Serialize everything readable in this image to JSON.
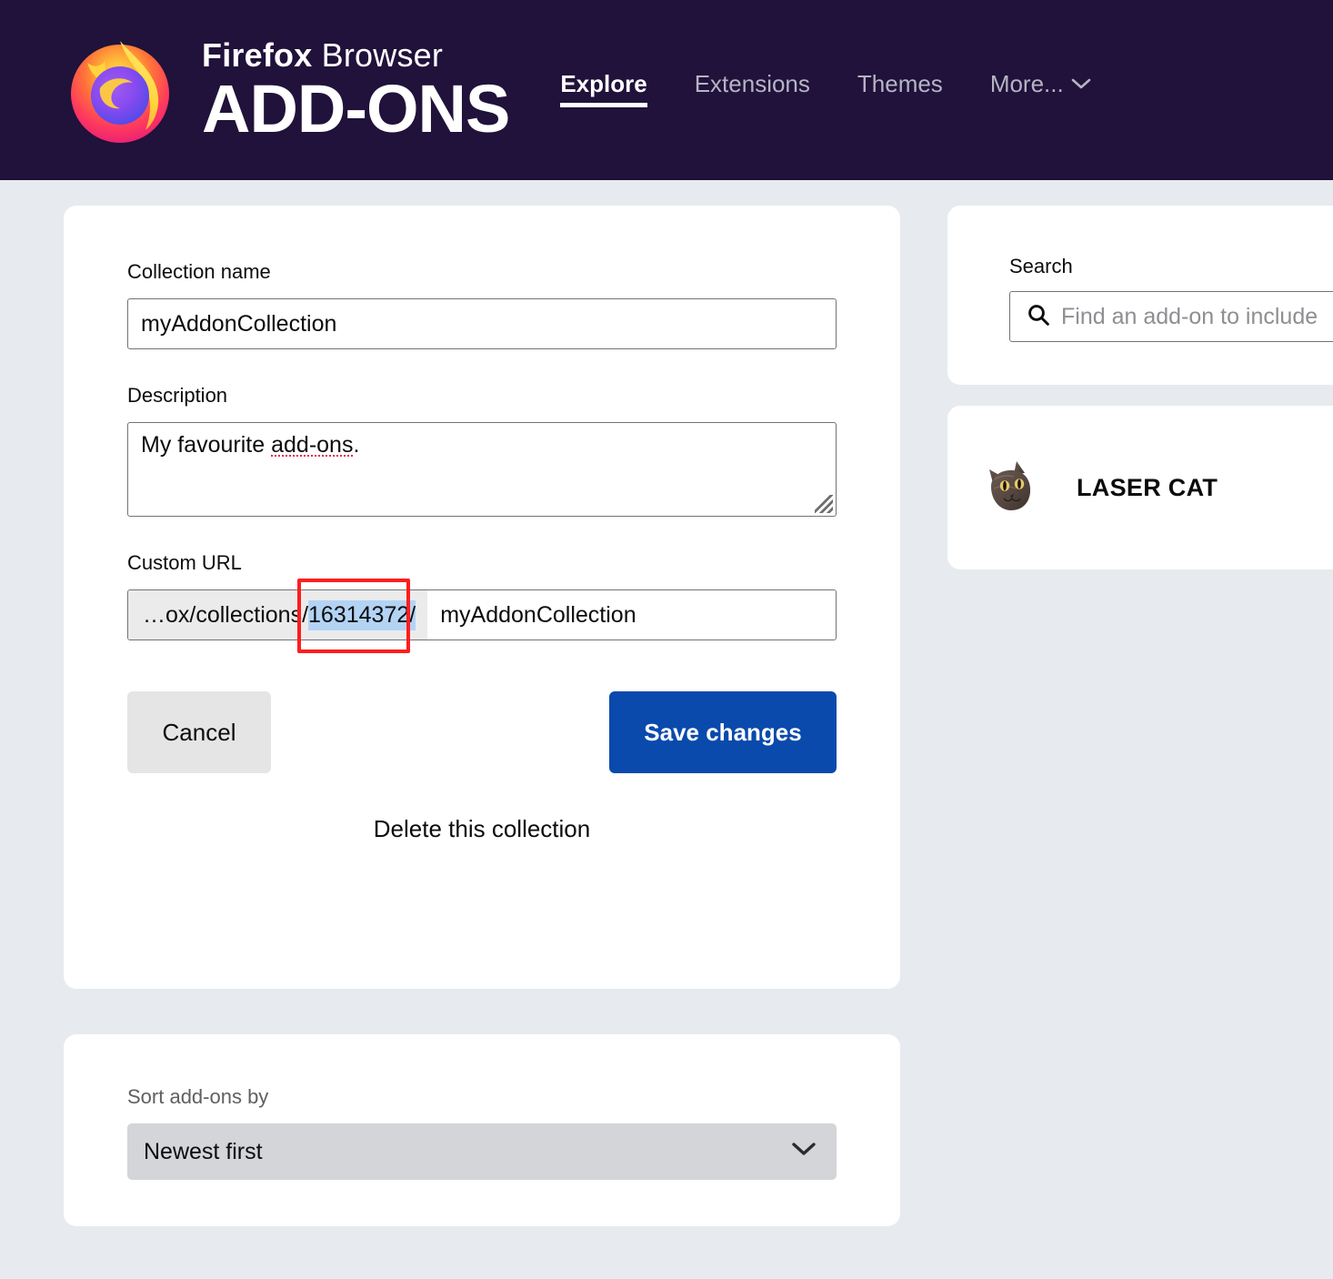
{
  "header": {
    "brand_top_bold": "Firefox",
    "brand_top_light": " Browser",
    "brand_main": "ADD-ONS",
    "logo_icon": "firefox-logo-icon",
    "nav": [
      {
        "label": "Explore",
        "active": true
      },
      {
        "label": "Extensions",
        "active": false
      },
      {
        "label": "Themes",
        "active": false
      },
      {
        "label": "More...",
        "active": false,
        "chevron": "⌄"
      }
    ]
  },
  "collection_form": {
    "name_label": "Collection name",
    "name_value": "myAddonCollection",
    "description_label": "Description",
    "description_text_plain": "My favourite ",
    "description_text_misspelled": "add-ons",
    "description_text_end": ".",
    "url_label": "Custom URL",
    "url_prefix": "…ox/collections/",
    "url_prefix_static": "…ox/collections/",
    "url_selected_id": "16314372",
    "url_selected_slash": "/",
    "url_value": "myAddonCollection",
    "cancel_label": "Cancel",
    "save_label": "Save changes",
    "delete_label": "Delete this collection"
  },
  "sort": {
    "label": "Sort add-ons by",
    "selected": "Newest first",
    "chevron_icon": "chevron-down-icon"
  },
  "search": {
    "label": "Search",
    "placeholder": "Find an add-on to include",
    "value": "",
    "icon": "search-icon"
  },
  "addon": {
    "title": "LASER CAT",
    "thumb_icon": "laser-cat-thumbnail-icon"
  },
  "colors": {
    "header_background": "#20123a",
    "page_background": "#e7eaee",
    "card_background": "#ffffff",
    "primary_button": "#0a4aad",
    "secondary_button": "#e5e5e5",
    "annotation_outline": "#ff1d1d",
    "text_selection": "#b3d3f5",
    "prefix_background": "#ebebeb",
    "select_background": "#d3d5d9",
    "spellcheck_underline": "#e22850"
  }
}
